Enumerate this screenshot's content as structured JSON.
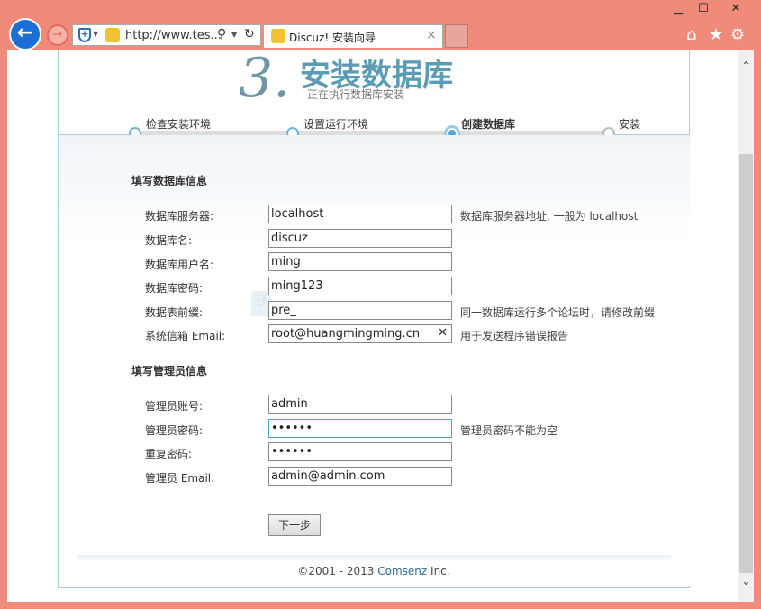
{
  "window": {
    "minimize": "▁",
    "maximize": "☐",
    "close": "✕"
  },
  "browser": {
    "address": "http://www.tes...",
    "tab_title": "Discuz! 安装向导",
    "tab_close": "×",
    "back": "←",
    "forward": "→"
  },
  "header": {
    "step_number": "3.",
    "title": "安装数据库",
    "subtitle": "正在执行数据库安装"
  },
  "steps": [
    {
      "label": "检查安装环境",
      "state": "done"
    },
    {
      "label": "设置运行环境",
      "state": "done"
    },
    {
      "label": "创建数据库",
      "state": "current"
    },
    {
      "label": "安装",
      "state": "pending"
    }
  ],
  "db_section": {
    "title": "填写数据库信息",
    "fields": [
      {
        "label": "数据库服务器:",
        "value": "localhost",
        "hint": "数据库服务器地址, 一般为 localhost"
      },
      {
        "label": "数据库名:",
        "value": "discuz",
        "hint": ""
      },
      {
        "label": "数据库用户名:",
        "value": "ming",
        "hint": ""
      },
      {
        "label": "数据库密码:",
        "value": "ming123",
        "hint": ""
      },
      {
        "label": "数据表前缀:",
        "value": "pre_",
        "hint": "同一数据库运行多个论坛时，请修改前缀"
      },
      {
        "label": "系统信箱 Email:",
        "value": "root@huangmingming.cn",
        "hint": "用于发送程序错误报告"
      }
    ]
  },
  "admin_section": {
    "title": "填写管理员信息",
    "fields": [
      {
        "label": "管理员账号:",
        "value": "admin",
        "hint": ""
      },
      {
        "label": "管理员密码:",
        "value": "••••••",
        "hint": "管理员密码不能为空"
      },
      {
        "label": "重复密码:",
        "value": "••••••",
        "hint": ""
      },
      {
        "label": "管理员 Email:",
        "value": "admin@admin.com",
        "hint": ""
      }
    ]
  },
  "next_button": "下一步",
  "footer": {
    "prefix": "©2001 - 2013 ",
    "brand": "Comsenz",
    "suffix": " Inc."
  },
  "colors": {
    "chrome": "#f08a7a",
    "accent": "#5b9bb3",
    "link": "#2b6a96"
  }
}
